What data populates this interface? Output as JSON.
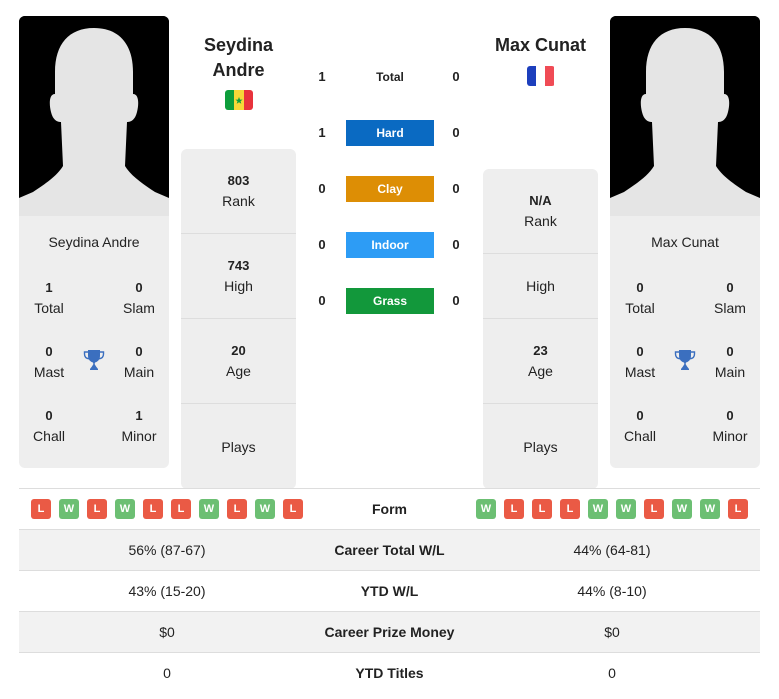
{
  "player1": {
    "name": "Seydina Andre",
    "name_line1": "Seydina",
    "name_line2": "Andre",
    "flag": "senegal-flag",
    "flag_colors": [
      "#0d9e3b",
      "#f6d838",
      "#e8323c"
    ],
    "titles": {
      "total": {
        "value": "1",
        "label": "Total"
      },
      "slam": {
        "value": "0",
        "label": "Slam"
      },
      "mast": {
        "value": "0",
        "label": "Mast"
      },
      "main": {
        "value": "0",
        "label": "Main"
      },
      "chall": {
        "value": "0",
        "label": "Chall"
      },
      "minor": {
        "value": "1",
        "label": "Minor"
      }
    },
    "stats": {
      "rank": {
        "value": "803",
        "label": "Rank"
      },
      "high": {
        "value": "743",
        "label": "High"
      },
      "age": {
        "value": "20",
        "label": "Age"
      },
      "plays": {
        "value": "",
        "label": "Plays"
      }
    },
    "form": [
      "L",
      "W",
      "L",
      "W",
      "L",
      "L",
      "W",
      "L",
      "W",
      "L"
    ]
  },
  "player2": {
    "name": "Max Cunat",
    "flag": "france-flag",
    "flag_colors": [
      "#1d3fbd",
      "#ffffff",
      "#f04b55"
    ],
    "titles": {
      "total": {
        "value": "0",
        "label": "Total"
      },
      "slam": {
        "value": "0",
        "label": "Slam"
      },
      "mast": {
        "value": "0",
        "label": "Mast"
      },
      "main": {
        "value": "0",
        "label": "Main"
      },
      "chall": {
        "value": "0",
        "label": "Chall"
      },
      "minor": {
        "value": "0",
        "label": "Minor"
      }
    },
    "stats": {
      "rank": {
        "value": "N/A",
        "label": "Rank"
      },
      "high": {
        "value": "",
        "label": "High"
      },
      "age": {
        "value": "23",
        "label": "Age"
      },
      "plays": {
        "value": "",
        "label": "Plays"
      }
    },
    "form": [
      "W",
      "L",
      "L",
      "L",
      "W",
      "W",
      "L",
      "W",
      "W",
      "L"
    ]
  },
  "h2h": [
    {
      "label": "Total",
      "p1": "1",
      "p2": "0",
      "color": null
    },
    {
      "label": "Hard",
      "p1": "1",
      "p2": "0",
      "color": "#0a6ac2"
    },
    {
      "label": "Clay",
      "p1": "0",
      "p2": "0",
      "color": "#dd8e05"
    },
    {
      "label": "Indoor",
      "p1": "0",
      "p2": "0",
      "color": "#2d9cf5"
    },
    {
      "label": "Grass",
      "p1": "0",
      "p2": "0",
      "color": "#12983b"
    }
  ],
  "comparison": {
    "form_label": "Form",
    "rows": [
      {
        "label": "Career Total W/L",
        "p1": "56% (87-67)",
        "p2": "44% (64-81)"
      },
      {
        "label": "YTD W/L",
        "p1": "43% (15-20)",
        "p2": "44% (8-10)"
      },
      {
        "label": "Career Prize Money",
        "p1": "$0",
        "p2": "$0"
      },
      {
        "label": "YTD Titles",
        "p1": "0",
        "p2": "0"
      }
    ]
  },
  "colors": {
    "win": "#6cbf73",
    "loss": "#ea5a45",
    "trophy": "#3b6fbf",
    "card_bg": "#eeeeee"
  }
}
